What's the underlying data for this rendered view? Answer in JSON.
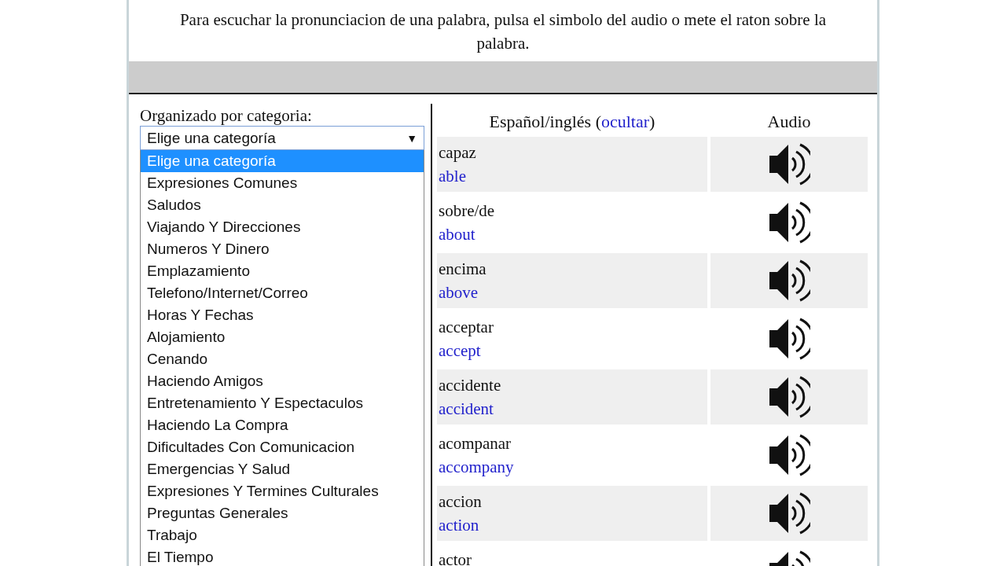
{
  "instructions": "Para escuchar la pronunciacion de una palabra, pulsa el simbolo del audio o mete el raton sobre la palabra.",
  "category": {
    "label": "Organizado por categoria:",
    "value": "Elige una categoría",
    "caret": "▼",
    "options": [
      {
        "label": "Elige una categoría",
        "selected": true
      },
      {
        "label": "Expresiones Comunes",
        "selected": false
      },
      {
        "label": "Saludos",
        "selected": false
      },
      {
        "label": "Viajando Y Direcciones",
        "selected": false
      },
      {
        "label": "Numeros Y Dinero",
        "selected": false
      },
      {
        "label": "Emplazamiento",
        "selected": false
      },
      {
        "label": "Telefono/Internet/Correo",
        "selected": false
      },
      {
        "label": "Horas Y Fechas",
        "selected": false
      },
      {
        "label": "Alojamiento",
        "selected": false
      },
      {
        "label": "Cenando",
        "selected": false
      },
      {
        "label": "Haciendo Amigos",
        "selected": false
      },
      {
        "label": "Entretenamiento Y Espectaculos",
        "selected": false
      },
      {
        "label": "Haciendo La Compra",
        "selected": false
      },
      {
        "label": "Dificultades Con Comunicacion",
        "selected": false
      },
      {
        "label": "Emergencias Y Salud",
        "selected": false
      },
      {
        "label": "Expresiones Y Termines Culturales",
        "selected": false
      },
      {
        "label": "Preguntas Generales",
        "selected": false
      },
      {
        "label": "Trabajo",
        "selected": false
      },
      {
        "label": "El Tiempo",
        "selected": false
      }
    ]
  },
  "table": {
    "columns": [
      {
        "label": "Español/inglés",
        "open": "(",
        "link": "ocultar",
        "close": ")"
      },
      {
        "label": "Audio"
      }
    ],
    "rows": [
      {
        "es": "capaz",
        "en": "able"
      },
      {
        "es": "sobre/de",
        "en": "about"
      },
      {
        "es": "encima",
        "en": "above"
      },
      {
        "es": "acceptar",
        "en": "accept"
      },
      {
        "es": "accidente",
        "en": "accident"
      },
      {
        "es": "acompanar",
        "en": "accompany"
      },
      {
        "es": "accion",
        "en": "action"
      },
      {
        "es": "actor"
      }
    ]
  }
}
